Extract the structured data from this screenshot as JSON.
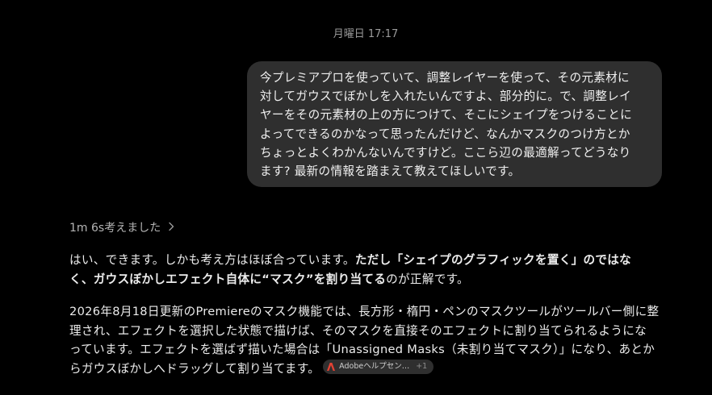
{
  "header": {
    "timestamp": "月曜日 17:17"
  },
  "user_message": {
    "lines": [
      "今プレミアプロを使っていて、調整レイヤーを使って、その元素材に",
      "対してガウスでぼかしを入れたいんですよ、部分的に。で、調整レイ",
      "ヤーをその元素材の上の方につけて、そこにシェイプをつけることに",
      "よってできるのかなって思ったんだけど、なんかマスクのつけ方とか",
      "ちょっとよくわかんないんですけど。ここら辺の最適解ってどうなり",
      "ます? 最新の情報を踏まえて教えてほしいです。"
    ]
  },
  "thought": {
    "label": "1m 6s考えました"
  },
  "assistant": {
    "para1": {
      "l1_normal": "はい、できます。しかも考え方はほぼ合っています。",
      "l1_bold": "ただし「シェイプのグラフィックを置く」のではな",
      "l2_bold": "く、ガウスぼかしエフェクト自体に“マスク”を割り当てる",
      "l2_normal": "のが正解です。"
    },
    "para2": {
      "lines": [
        "2026年8月18日更新のPremiereのマスク機能では、長方形・楕円・ペンのマスクツールがツールバー側に整",
        "理され、エフェクトを選択した状態で描けば、そのマスクを直接そのエフェクトに割り当てられるようにな",
        "っています。エフェクトを選ばず描いた場合は「Unassigned Masks（未割り当てマスク）」になり、あとか"
      ],
      "last_line": "らガウスぼかしへドラッグして割り当てます。"
    },
    "source_chip": {
      "label": "Adobeヘルプセン…",
      "extra": "+1",
      "icon": "adobe-icon",
      "icon_color": "#e34234"
    }
  },
  "colors": {
    "background": "#000000",
    "bubble": "#2f2f2f",
    "text": "#ececec",
    "muted": "#9b9b9b"
  }
}
